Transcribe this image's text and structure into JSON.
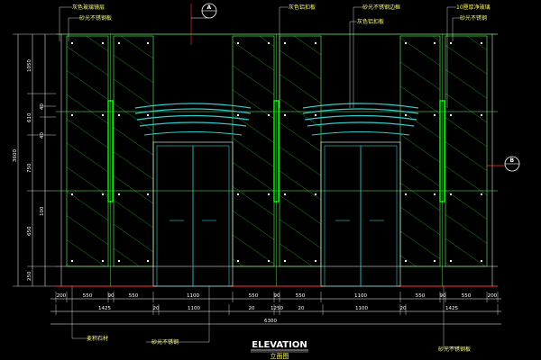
{
  "title": "ELEVATION",
  "subtitle": "立面图",
  "section_marker_top": "A",
  "section_marker_right": "B",
  "top_labels": [
    "灰色玻璃镜层",
    "砂光不锈钢板",
    "灰色铝扣板",
    "砂光不锈钢边框",
    "灰色铝扣板",
    "10厘厚净玻璃",
    "砂光不锈钢"
  ],
  "bottom_labels": [
    "麦积石材",
    "砂光不锈钢",
    "砂光不锈钢板"
  ],
  "top_dim_row": [
    "200",
    "550",
    "90",
    "550",
    "1100",
    "550",
    "90",
    "550",
    "1100",
    "550",
    "90",
    "550",
    "200"
  ],
  "middle_dim_row": [
    "1425",
    "20",
    "1100",
    "20",
    "1250",
    "20",
    "1100",
    "20",
    "1425"
  ],
  "total_dim": "6300",
  "left_total_dim": "3600",
  "left_dims": [
    "1050",
    "610",
    "750",
    "650",
    "250"
  ],
  "left_sub_dims": [
    "40",
    "40",
    "100"
  ],
  "colors": {
    "background": "#000000",
    "glass_hatch": "#33cc33",
    "panel_line": "#66ff66",
    "door_line": "#33cccc",
    "wall_line": "#ffffff",
    "floor_line": "#ff3333",
    "label_text": "#ffff66",
    "dim_text": "#ffffff",
    "arc_line": "#33cccc"
  }
}
